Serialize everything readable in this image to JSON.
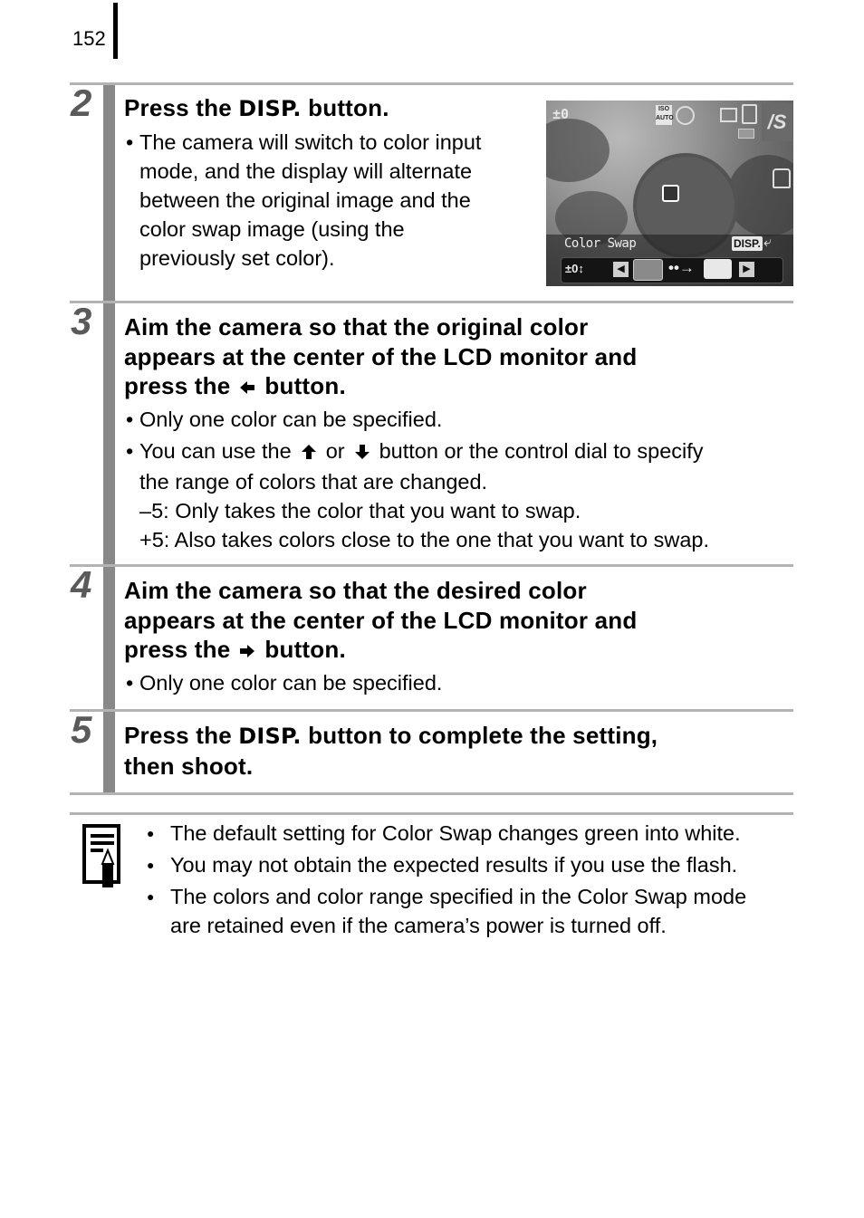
{
  "page": {
    "number": "152"
  },
  "steps": [
    {
      "number": "2",
      "title_before": "Press the ",
      "title_disp": "DISP.",
      "title_after": " button.",
      "bullets": [
        {
          "lines": [
            "The camera will switch to color input",
            "mode, and the display will alternate",
            "between the original image and the",
            "color swap image (using the",
            "previously set color)."
          ]
        }
      ]
    },
    {
      "number": "3",
      "title_lines": [
        "Aim the camera so that the original color",
        "appears at the center of the LCD monitor and"
      ],
      "title_last_before": "press the",
      "title_last_icon": "left-arrow-icon",
      "title_last_after": "button.",
      "bullets": [
        {
          "text": "Only one color can be specified."
        },
        {
          "text_before": "You can use the",
          "icon1": "up-arrow-icon",
          "text_mid": "or",
          "icon2": "down-arrow-icon",
          "text_after": "button or the control dial to specify",
          "cont": "the range of colors that are changed.",
          "sub": [
            "–5: Only takes the color that you want to swap.",
            "+5: Also takes colors close to the one that you want to swap."
          ]
        }
      ]
    },
    {
      "number": "4",
      "title_lines": [
        "Aim the camera so that the desired color",
        "appears at the center of the LCD monitor and"
      ],
      "title_last_before": "press the",
      "title_last_icon": "right-arrow-icon",
      "title_last_after": "button.",
      "bullets": [
        {
          "text": "Only one color can be specified."
        }
      ]
    },
    {
      "number": "5",
      "title_before": "Press the ",
      "title_disp": "DISP.",
      "title_after": " button to complete the setting,",
      "title_line2": "then shoot."
    }
  ],
  "lcd": {
    "exposure": "±0",
    "iso": "ISO AUTO",
    "mode_label": "Color Swap",
    "disp_label": "DISP.",
    "back_icon": "⤶",
    "range_value": "±0↕",
    "left_btn": "◀",
    "right_btn": "▶",
    "swap_arrow": "••→",
    "mode_icon_text": "/S",
    "colors": {
      "original": "#8a8a8a",
      "target": "#e8e8e8"
    }
  },
  "memo": {
    "items": [
      {
        "text": "The default setting for Color Swap changes green into white."
      },
      {
        "text": "You may not obtain the expected results if you use the flash."
      },
      {
        "text": "The colors and color range specified in the Color Swap mode",
        "cont": "are retained even if the camera’s power is turned off."
      }
    ]
  }
}
